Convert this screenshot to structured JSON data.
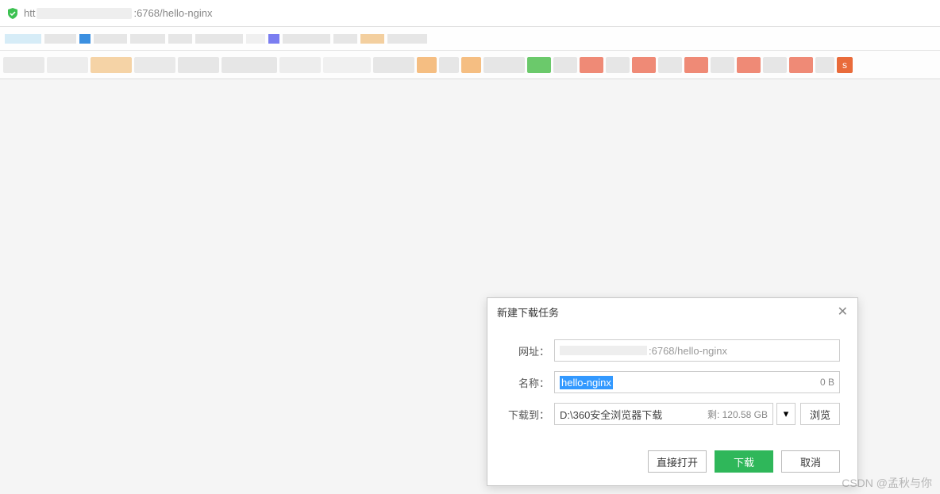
{
  "addressBar": {
    "protocol": "htt",
    "portPath": ":6768/hello-nginx"
  },
  "dialog": {
    "title": "新建下载任务",
    "labels": {
      "url": "网址：",
      "name": "名称：",
      "saveTo": "下载到："
    },
    "url": {
      "suffix": ":6768/hello-nginx"
    },
    "name": {
      "value": "hello-nginx",
      "size": "0 B"
    },
    "saveTo": {
      "path": "D:\\360安全浏览器下载",
      "remain": "剩: 120.58 GB",
      "browse": "浏览"
    },
    "buttons": {
      "open": "直接打开",
      "download": "下载",
      "cancel": "取消"
    }
  },
  "watermark": "CSDN @孟秋与你"
}
